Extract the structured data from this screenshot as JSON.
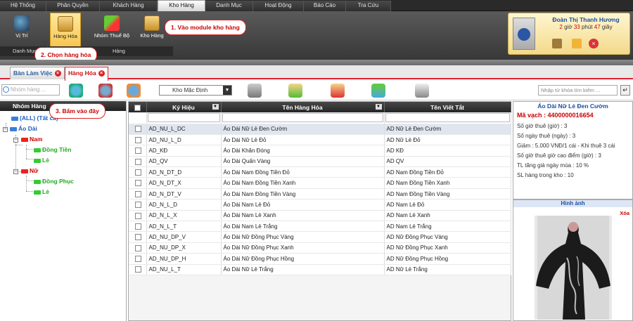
{
  "menu": {
    "tabs": [
      "Hệ Thống",
      "Phân Quyền",
      "Khách Hàng",
      "Kho Hàng",
      "Danh Mục",
      "Hoạt Động",
      "Báo Cáo",
      "Tra Cứu"
    ]
  },
  "ribbon": {
    "buttons": [
      "Vị Trí",
      "Hàng Hóa",
      "Nhóm Thuế Bộ",
      "Kho Hàng"
    ],
    "groups": [
      "Danh Mục",
      "Hàng"
    ]
  },
  "user": {
    "name": "Đoàn Thị Thanh Hương",
    "hours": "2",
    "hours_label": "giờ",
    "minutes": "33",
    "minutes_label": "phút",
    "seconds": "47",
    "seconds_label": "giây"
  },
  "callouts": {
    "c1": "1. Vào module kho hàng",
    "c2": "2. Chọn hàng hóa",
    "c3": "3. Bấm vào đây"
  },
  "tabs": {
    "t1": "Bàn Làm Việc",
    "t2": "Hàng Hóa",
    "close": "×"
  },
  "toolbar": {
    "search_placeholder": "Nhóm hàng ...",
    "warehouse": "Kho Mặc Định",
    "keyword_placeholder": "Nhập từ khóa tìm kiếm ..."
  },
  "tree": {
    "header": "Nhóm Hàng",
    "nodes": [
      "(ALL) (Tất cả)",
      "Áo Dài",
      "Nam",
      "Đồng Tiền",
      "Lẻ",
      "Nữ",
      "Đồng Phục",
      "Lẻ"
    ]
  },
  "grid": {
    "columns": [
      "Ký Hiệu",
      "Tên Hàng Hóa",
      "Tên Viết Tắt"
    ],
    "rows": [
      [
        "AD_NU_L_DC",
        "Áo Dài Nữ Lẻ Đen Cườm",
        "AD Nữ Lẻ Đen Cườm"
      ],
      [
        "AD_NU_L_D",
        "Áo Dài Nữ Lẻ Đỏ",
        "AD Nữ Lẻ Đỏ"
      ],
      [
        "AD_KĐ",
        "Áo Dài Khăn Đóng",
        "AD KĐ"
      ],
      [
        "AD_QV",
        "Áo Dài Quấn Vàng",
        "AD QV"
      ],
      [
        "AD_N_DT_D",
        "Áo Dài Nam Đồng Tiền Đỏ",
        "AD Nam Đồng Tiền Đỏ"
      ],
      [
        "AD_N_DT_X",
        "Áo Dài Nam Đồng Tiền Xanh",
        "AD Nam Đồng Tiền Xanh"
      ],
      [
        "AD_N_DT_V",
        "Áo Dài Nam Đồng Tiền Vàng",
        "AD Nam Đồng Tiền Vàng"
      ],
      [
        "AD_N_L_D",
        "Áo Dài Nam Lẻ Đỏ",
        "AD Nam Lẻ Đỏ"
      ],
      [
        "AD_N_L_X",
        "Áo Dài Nam Lẻ Xanh",
        "AD Nam Lẻ Xanh"
      ],
      [
        "AD_N_L_T",
        "Áo Dài Nam Lẻ Trắng",
        "AD Nam Lẻ Trắng"
      ],
      [
        "AD_NU_DP_V",
        "Áo Dài Nữ Đồng Phục Vàng",
        "AD Nữ Đồng Phục Vàng"
      ],
      [
        "AD_NU_DP_X",
        "Áo Dài Nữ Đồng Phục Xanh",
        "AD Nữ Đồng Phục Xanh"
      ],
      [
        "AD_NU_DP_H",
        "Áo Dài Nữ Đồng Phục Hồng",
        "AD Nữ Đồng Phục Hồng"
      ],
      [
        "AD_NU_L_T",
        "Áo Dài Nữ Lẻ Trắng",
        "AD Nữ Lẻ Trắng"
      ]
    ]
  },
  "detail": {
    "title": "Áo Dài Nữ Lẻ Đen Cườm",
    "barcode": "Mã vạch : 4400000016654",
    "lines": [
      "Số giờ thuê (giờ) : 3",
      "Số ngày thuê (ngày) : 3",
      "Giảm : 5.000 VNĐ/1 cái - Khi thuê 3 cái",
      "Số giờ thuê giờ cao điểm (giờ) : 3",
      "TL tăng giá ngày mùa : 10 %",
      "SL hàng trong kho : 10"
    ]
  },
  "image_panel": {
    "title": "Hình ảnh",
    "delete": "Xóa"
  }
}
